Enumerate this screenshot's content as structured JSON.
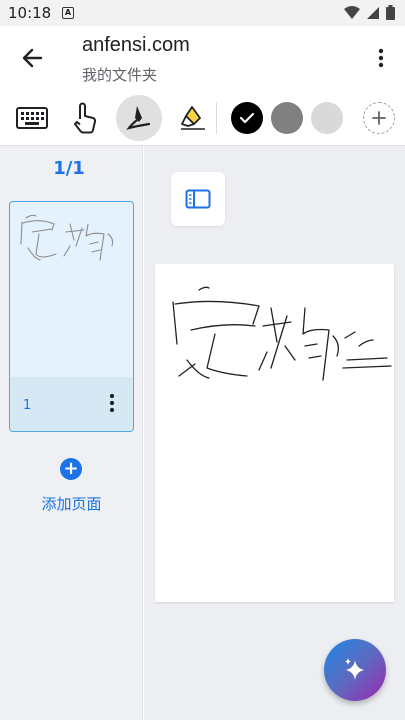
{
  "status_bar": {
    "time": "10:18",
    "notification_letter": "A"
  },
  "app_bar": {
    "title": "anfensi.com",
    "subtitle": "我的文件夹"
  },
  "toolbar": {
    "tools": [
      "keyboard-icon",
      "hand-icon",
      "pen-icon",
      "highlighter-icon"
    ],
    "active_tool": "pen-icon",
    "colors": [
      "#000000",
      "#808080",
      "#d9d9d9"
    ],
    "selected_color": "#000000"
  },
  "sidebar": {
    "page_counter": "1/1",
    "thumbnail_page_number": "1",
    "add_page_label": "添加页面",
    "add_page_symbol": "+"
  },
  "accent_color": "#1a73e8"
}
